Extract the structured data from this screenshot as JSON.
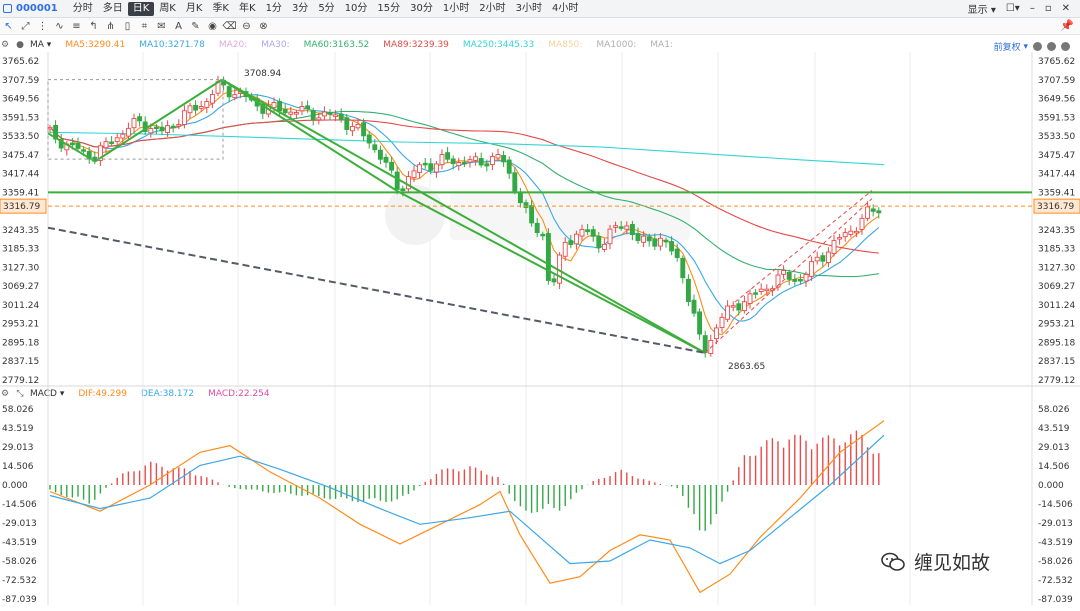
{
  "toolbar": {
    "symbol": "000001",
    "timeframes": [
      "分时",
      "多日",
      "日K",
      "周K",
      "月K",
      "季K",
      "年K",
      "1分",
      "3分",
      "5分",
      "10分",
      "15分",
      "30分",
      "1小时",
      "2小时",
      "3小时",
      "4小时"
    ],
    "active_timeframe": "日K",
    "display_label": "显示"
  },
  "legend": {
    "indicator": "MA",
    "items": [
      {
        "text": "MA5:3290.41",
        "color": "#ff8c1a"
      },
      {
        "text": "MA10:3271.78",
        "color": "#3aa7e8"
      },
      {
        "text": "MA20:",
        "color": "#e6a8d7"
      },
      {
        "text": "MA30:",
        "color": "#a9a9f0"
      },
      {
        "text": "MA60:3163.52",
        "color": "#35b070"
      },
      {
        "text": "MA89:3239.39",
        "color": "#e64a4a"
      },
      {
        "text": "MA250:3445.33",
        "color": "#33d6d6"
      },
      {
        "text": "MA850:",
        "color": "#f5d59a"
      },
      {
        "text": "MA1000:",
        "color": "#b0b0b0"
      },
      {
        "text": "MA1:",
        "color": "#b0b0b0"
      }
    ],
    "adjust": "前复权"
  },
  "macd_legend": {
    "indicator": "MACD",
    "items": [
      {
        "text": "DIF:49.299",
        "color": "#ff8c1a"
      },
      {
        "text": "DEA:38.172",
        "color": "#3aa7e8"
      },
      {
        "text": "MACD:22.254",
        "color": "#e64aa8"
      }
    ]
  },
  "colors": {
    "up": "#e84a4a",
    "down": "#33a845",
    "trend": "#3cae3a",
    "hline": "#3cae3a",
    "current": "#ff8c1a",
    "dash": "#555a66"
  },
  "price_axis": {
    "ticks": [
      "3765.62",
      "3707.59",
      "3649.56",
      "3591.53",
      "3533.50",
      "3475.47",
      "3417.44",
      "3359.41",
      "3243.35",
      "3185.33",
      "3127.30",
      "3069.27",
      "3011.24",
      "2953.21",
      "2895.18",
      "2837.15",
      "2779.12"
    ],
    "current": "3316.79",
    "current_value": 3316.79,
    "high_value": 3359.41
  },
  "macd_axis": {
    "ticks": [
      "58.026",
      "43.519",
      "29.013",
      "14.506",
      "0.000",
      "-14.506",
      "-29.013",
      "-43.519",
      "-58.026",
      "-72.532",
      "-87.039"
    ]
  },
  "annotations": {
    "high": "3708.94",
    "low": "2863.65"
  },
  "watermark": {
    "text": "缠见如故"
  }
}
